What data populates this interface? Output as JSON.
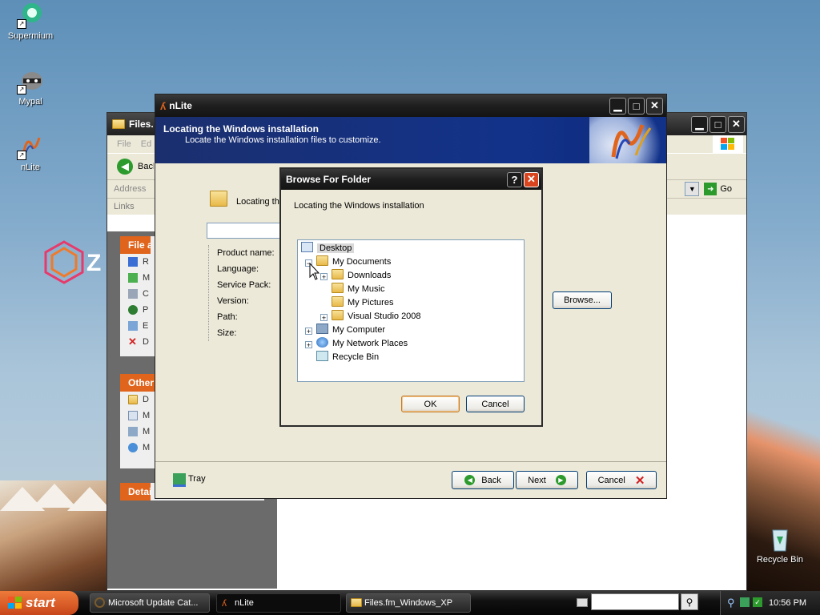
{
  "desktop": {
    "icons": [
      {
        "label": "Supermium"
      },
      {
        "label": "Mypal"
      },
      {
        "label": "nLite"
      },
      {
        "label": "Recycle Bin"
      }
    ],
    "shortcut_arrow": "↗",
    "zune_letter": "Z"
  },
  "files_window": {
    "title": "Files.fm_Windows_XP",
    "menu": [
      "File",
      "Ed"
    ],
    "back_label": "Back",
    "address_label": "Address",
    "go_label": "Go",
    "links_label": "Links",
    "panel1_title": "File and Folder Tasks",
    "panel1_items": [
      "R",
      "M",
      "C",
      "P",
      "E",
      "D"
    ],
    "panel2_title": "Other Places",
    "panel2_items": [
      "D",
      "M",
      "M",
      "M"
    ],
    "panel3_title": "Details"
  },
  "nlite_window": {
    "title": "nLite",
    "header_title": "Locating the Windows installation",
    "header_subtitle": "Locate the Windows installation files to customize.",
    "locating_label": "Locating th",
    "browse_label": "Browse...",
    "fields": [
      "Product name:",
      "Language:",
      "Service Pack:",
      "Version:",
      "Path:",
      "Size:"
    ],
    "tray_label": "Tray",
    "back_label": "Back",
    "next_label": "Next",
    "cancel_label": "Cancel"
  },
  "browse_dialog": {
    "title": "Browse For Folder",
    "description": "Locating the Windows installation",
    "help_glyph": "?",
    "tree": [
      {
        "label": "Desktop",
        "selected": true
      },
      {
        "label": "My Documents",
        "expanded": true
      },
      {
        "label": "Downloads"
      },
      {
        "label": "My Music"
      },
      {
        "label": "My Pictures"
      },
      {
        "label": "Visual Studio 2008"
      },
      {
        "label": "My Computer"
      },
      {
        "label": "My Network Places"
      },
      {
        "label": "Recycle Bin"
      }
    ],
    "ok_label": "OK",
    "cancel_label": "Cancel"
  },
  "taskbar": {
    "start_label": "start",
    "tasks": [
      {
        "label": "Microsoft Update Cat..."
      },
      {
        "label": "nLite",
        "active": true
      },
      {
        "label": "Files.fm_Windows_XP"
      }
    ],
    "search_value": "",
    "clock": "10:56 PM"
  },
  "colors": {
    "accent_orange": "#e0641c",
    "nlite_header_blue": "#12328a",
    "title_dark": "#1e1e1e"
  }
}
